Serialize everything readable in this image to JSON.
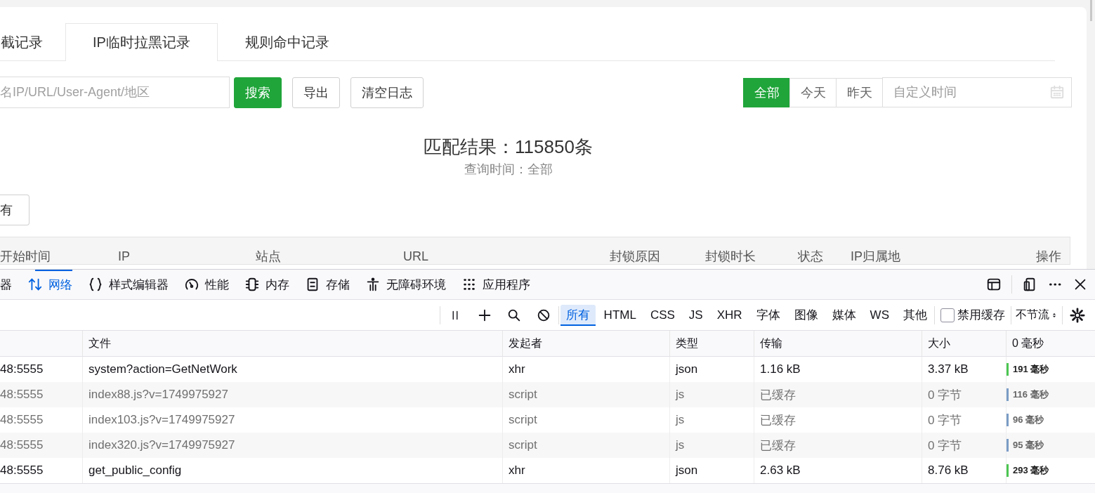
{
  "page_tabs": [
    {
      "label": "截记录",
      "selected": false
    },
    {
      "label": "IP临时拉黑记录",
      "selected": true
    },
    {
      "label": "规则命中记录",
      "selected": false
    }
  ],
  "search": {
    "placeholder": "名IP/URL/User-Agent/地区"
  },
  "buttons": [
    {
      "label": "搜索",
      "kind": "primary"
    },
    {
      "label": "导出",
      "kind": "plain"
    },
    {
      "label": "清空日志",
      "kind": "plain"
    }
  ],
  "date_filters": [
    {
      "label": "全部",
      "selected": true
    },
    {
      "label": "今天",
      "selected": false
    },
    {
      "label": "昨天",
      "selected": false
    }
  ],
  "date_picker": {
    "placeholder": "自定义时间"
  },
  "result": {
    "title": "匹配结果：115850条",
    "subtitle": "查询时间：全部"
  },
  "filter_button": "有",
  "log_table": {
    "columns": [
      "开始时间",
      "IP",
      "站点",
      "URL",
      "封锁原因",
      "封锁时长",
      "状态",
      "IP归属地",
      "操作"
    ]
  },
  "devtools": {
    "tabs": [
      {
        "label": "器",
        "selected": false
      },
      {
        "label": "网络",
        "selected": true
      },
      {
        "label": "样式编辑器",
        "selected": false
      },
      {
        "label": "性能",
        "selected": false
      },
      {
        "label": "内存",
        "selected": false
      },
      {
        "label": "存储",
        "selected": false
      },
      {
        "label": "无障碍环境",
        "selected": false
      },
      {
        "label": "应用程序",
        "selected": false
      }
    ],
    "type_filters": [
      {
        "label": "所有",
        "selected": true
      },
      {
        "label": "HTML",
        "selected": false
      },
      {
        "label": "CSS",
        "selected": false
      },
      {
        "label": "JS",
        "selected": false
      },
      {
        "label": "XHR",
        "selected": false
      },
      {
        "label": "字体",
        "selected": false
      },
      {
        "label": "图像",
        "selected": false
      },
      {
        "label": "媒体",
        "selected": false
      },
      {
        "label": "WS",
        "selected": false
      },
      {
        "label": "其他",
        "selected": false
      }
    ],
    "disable_cache": {
      "label": "禁用缓存",
      "checked": false
    },
    "throttle": "不节流",
    "network_table": {
      "columns": [
        "",
        "文件",
        "发起者",
        "类型",
        "传输",
        "大小",
        "0 毫秒"
      ],
      "rows": [
        {
          "column_1": "48:5555",
          "file": "system?action=GetNetWork",
          "initiator": "xhr",
          "type": "json",
          "transferred": "1.16 kB",
          "size": "3.37 kB",
          "time": "191 毫秒",
          "cached": false
        },
        {
          "column_1": "48:5555",
          "file": "index88.js?v=1749975927",
          "initiator": "script",
          "type": "js",
          "transferred": "已缓存",
          "size": "0 字节",
          "time": "116 毫秒",
          "cached": true
        },
        {
          "column_1": "48:5555",
          "file": "index103.js?v=1749975927",
          "initiator": "script",
          "type": "js",
          "transferred": "已缓存",
          "size": "0 字节",
          "time": "96 毫秒",
          "cached": true
        },
        {
          "column_1": "48:5555",
          "file": "index320.js?v=1749975927",
          "initiator": "script",
          "type": "js",
          "transferred": "已缓存",
          "size": "0 字节",
          "time": "95 毫秒",
          "cached": true
        },
        {
          "column_1": "48:5555",
          "file": "get_public_config",
          "initiator": "xhr",
          "type": "json",
          "transferred": "2.63 kB",
          "size": "8.76 kB",
          "time": "293 毫秒",
          "cached": false
        }
      ]
    }
  }
}
